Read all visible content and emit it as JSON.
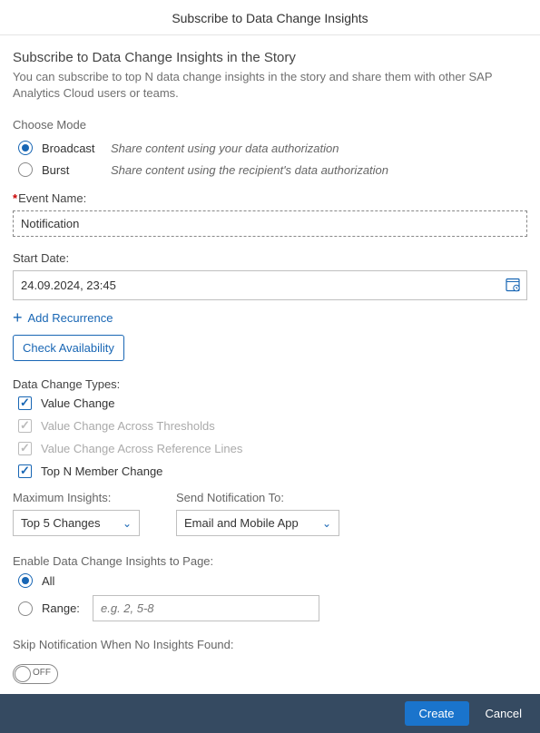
{
  "dialogTitle": "Subscribe to Data Change Insights",
  "story": {
    "title": "Subscribe to Data Change Insights in the Story",
    "desc": "You can subscribe to top N data change insights in the story and share them with other SAP Analytics Cloud users or teams."
  },
  "mode": {
    "label": "Choose Mode",
    "options": [
      {
        "label": "Broadcast",
        "hint": "Share content using your data authorization",
        "checked": true
      },
      {
        "label": "Burst",
        "hint": "Share content using the recipient's data authorization",
        "checked": false
      }
    ]
  },
  "eventName": {
    "label": "Event Name:",
    "value": "Notification"
  },
  "startDate": {
    "label": "Start Date:",
    "value": "24.09.2024, 23:45"
  },
  "addRecurrence": "Add Recurrence",
  "checkAvailability": "Check Availability",
  "dataChangeTypes": {
    "label": "Data Change Types:",
    "items": [
      {
        "label": "Value Change",
        "checked": true,
        "disabled": false
      },
      {
        "label": "Value Change Across Thresholds",
        "checked": true,
        "disabled": true
      },
      {
        "label": "Value Change Across Reference Lines",
        "checked": true,
        "disabled": true
      },
      {
        "label": "Top N Member Change",
        "checked": true,
        "disabled": false
      }
    ]
  },
  "maxInsights": {
    "label": "Maximum Insights:",
    "value": "Top 5 Changes"
  },
  "sendNotification": {
    "label": "Send Notification To:",
    "value": "Email and Mobile App"
  },
  "enablePage": {
    "label": "Enable Data Change Insights to Page:",
    "all": "All",
    "range": "Range:",
    "rangePlaceholder": "e.g. 2, 5-8"
  },
  "skipNotification": {
    "label": "Skip Notification When No Insights Found:",
    "value": "OFF"
  },
  "footer": {
    "create": "Create",
    "cancel": "Cancel"
  }
}
